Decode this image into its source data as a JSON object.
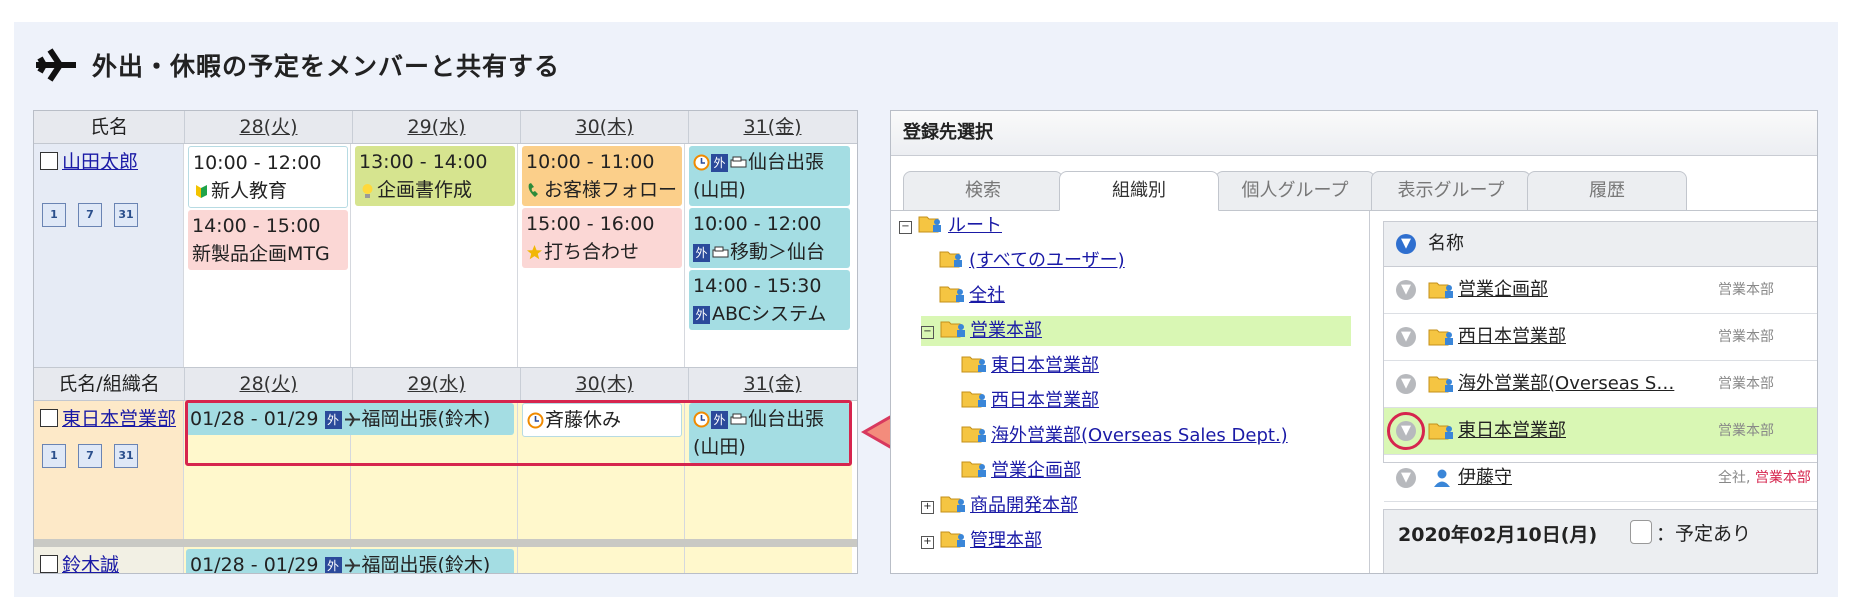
{
  "title": "外出・休暇の予定をメンバーと共有する",
  "schedule": {
    "header1": [
      "氏名",
      "28(火)",
      "29(水)",
      "30(木)",
      "31(金)"
    ],
    "header2": [
      "氏名/組織名",
      "28(火)",
      "29(水)",
      "30(木)",
      "31(金)"
    ],
    "person": {
      "name": "山田太郎",
      "cal_icons": [
        "1",
        "7",
        "31"
      ],
      "day1": [
        {
          "time": "10:00 - 12:00",
          "text": "新人教育",
          "icon": "beginner-mark-icon"
        },
        {
          "time": "14:00 - 15:00",
          "text": "新製品企画MTG"
        }
      ],
      "day2": [
        {
          "time": "13:00 - 14:00",
          "text": "企画書作成",
          "icon": "lightbulb-icon"
        }
      ],
      "day3": [
        {
          "time": "10:00 - 11:00",
          "text": "お客様フォロー",
          "icon": "phone-icon"
        },
        {
          "time": "15:00 - 16:00",
          "text": "打ち合わせ",
          "icon": "star-icon"
        }
      ],
      "day4": [
        {
          "line1": "仙台出張",
          "line2": "(山田)",
          "badge": "外"
        },
        {
          "time": "10:00 - 12:00",
          "text": "移動＞仙台",
          "badge": "外"
        },
        {
          "time": "14:00 - 15:30",
          "text": "ABCシステム",
          "badge": "外"
        }
      ]
    },
    "org": {
      "name": "東日本営業部",
      "cal_icons": [
        "1",
        "7",
        "31"
      ],
      "span_event": {
        "dates": "01/28 - 01/29",
        "badge": "外",
        "text": "福岡出張(鈴木)"
      },
      "day3": {
        "text": "斉藤休み"
      },
      "day4": {
        "line1": "仙台出張",
        "line2": "(山田)",
        "badge": "外"
      }
    },
    "next_row": {
      "name": "鈴木誠",
      "span_event": {
        "dates": "01/28 - 01/29",
        "badge": "外",
        "text": "福岡出張(鈴木)"
      }
    }
  },
  "register": {
    "title": "登録先選択",
    "tabs": [
      "検索",
      "組織別",
      "個人グループ",
      "表示グループ",
      "履歴"
    ],
    "active_tab": "組織別",
    "tree": [
      {
        "label": "ルート",
        "toggle": "⊟"
      },
      {
        "label": "(すべてのユーザー)"
      },
      {
        "label": "全社"
      },
      {
        "label": "営業本部",
        "toggle": "⊟"
      },
      {
        "label": "東日本営業部"
      },
      {
        "label": "西日本営業部"
      },
      {
        "label": "海外営業部(Overseas Sales Dept.)"
      },
      {
        "label": "営業企画部"
      },
      {
        "label": "商品開発本部",
        "toggle": "⊞"
      },
      {
        "label": "管理本部",
        "toggle": "⊞"
      }
    ],
    "list_header": "名称",
    "list": [
      {
        "name": "営業企画部",
        "parent": "営業本部"
      },
      {
        "name": "西日本営業部",
        "parent": "営業本部"
      },
      {
        "name": "海外営業部(Overseas S…",
        "parent": "営業本部"
      },
      {
        "name": "東日本営業部",
        "parent": "営業本部"
      },
      {
        "name": "伊藤守",
        "parent": "全社, ",
        "parent_red": "営業本部"
      }
    ],
    "date_label": "2020年02月10日(月)",
    "legend": "：予定あり"
  }
}
